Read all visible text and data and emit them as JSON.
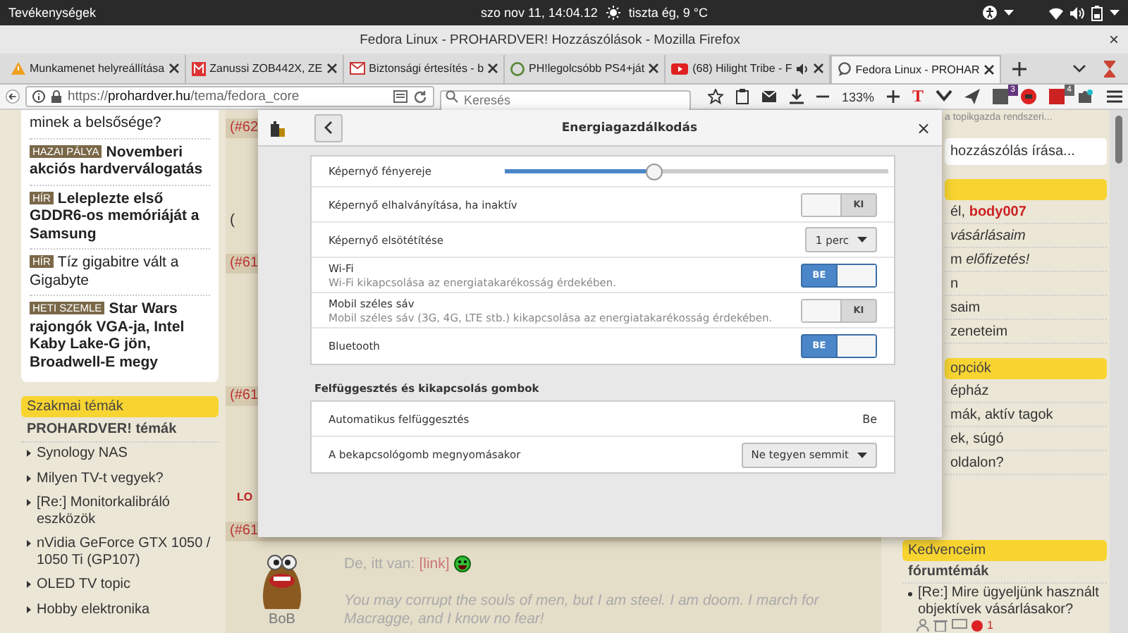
{
  "top_bar": {
    "activities": "Tevékenységek",
    "clock": "szo nov 11, 14:04.12",
    "weather": "tiszta ég, 9 °C"
  },
  "window": {
    "title": "Fedora Linux - PROHARDVER! Hozzászólások - Mozilla Firefox",
    "close": "×"
  },
  "tabs": [
    {
      "kind": "warning",
      "label": "Munkamenet helyreállítása",
      "audio": false,
      "selected": false
    },
    {
      "kind": "letter",
      "label": "Zanussi ZOB442X, ZE",
      "audio": false,
      "selected": false
    },
    {
      "kind": "mail",
      "label": "Biztonsági értesítés - b",
      "audio": false,
      "selected": false
    },
    {
      "kind": "circle",
      "label": "PH!legolcsóbb PS4+ját",
      "audio": false,
      "selected": false
    },
    {
      "kind": "play",
      "label": "(68) Hilight Tribe - F",
      "audio": true,
      "selected": false
    },
    {
      "kind": "bubble",
      "label": "Fedora Linux - PROHAR",
      "audio": false,
      "selected": true
    }
  ],
  "toolbar": {
    "url_scheme": "https://",
    "url_host": "prohardver.hu",
    "url_path": "/tema/fedora_core",
    "search_placeholder": "Keresés",
    "zoom": "133%",
    "logo_letter": "T",
    "badges": [
      "3",
      "4"
    ]
  },
  "left": {
    "news": [
      {
        "title": "minek a belsősége?",
        "bold": false
      },
      {
        "tag": "HAZAI PÁLYA",
        "title": "Novemberi akciós hardverválogatás",
        "bold": true
      },
      {
        "tag": "HÍR",
        "title": "Leleplezte első GDDR6-os memóriáját a Samsung",
        "bold": true
      },
      {
        "tag": "HÍR",
        "title": "Tíz gigabitre vált a Gigabyte",
        "bold": false
      },
      {
        "tag": "HETI SZEMLE",
        "title": "Star Wars rajongók VGA-ja, Intel Kaby Lake-G jön, Broadwell-E megy",
        "bold": true
      }
    ],
    "section": "Szakmai témák",
    "subheading": "PROHARDVER! témák",
    "topics": [
      "Synology NAS",
      "Milyen TV-t vegyek?",
      "[Re:] Monitorkalibráló eszközök",
      "nVidia GeForce GTX 1050 / 1050 Ti (GP107)",
      "OLED TV topic",
      "Hobby elektronika"
    ]
  },
  "middle": {
    "stubs": [
      {
        "number": "(#62",
        "trail": "(",
        "trail_flag": false
      },
      {
        "number": "(#61"
      },
      {
        "number": "(#61",
        "trail": "LO",
        "trail_flag": true
      }
    ],
    "post": {
      "number": "(#61",
      "author": "BoB",
      "text": "De, itt van: ",
      "link": "[link]",
      "signature": "You may corrupt the souls of men, but I am steel. I am doom. I march for Macragge, and I know no fear!"
    }
  },
  "right": {
    "notice": "a topikgazda rendszeri...",
    "compose": "hozzászólás írása...",
    "panels": [
      {
        "items": [
          {
            "text": "él, **body007**",
            "italic": false
          },
          {
            "text": "vásárlásaim",
            "italic": true
          },
          {
            "text": "m *előfizetés!*",
            "italic": false
          },
          {
            "text": "n",
            "italic": false
          },
          {
            "text": "saim",
            "italic": false
          },
          {
            "text": "zeneteim",
            "italic": false
          }
        ]
      },
      {
        "heading": "opciók",
        "items": [
          {
            "text": "épház",
            "italic": false
          },
          {
            "text": "mák, aktív tagok",
            "italic": false
          },
          {
            "text": "ek, súgó",
            "italic": false
          },
          {
            "text": "oldalon?",
            "italic": false
          }
        ]
      }
    ],
    "favorites": {
      "heading": "Kedvenceim",
      "subheading": "fórumtémák",
      "topic": "[Re:] Mire ügyeljünk használt objektívek vásárlásakor?",
      "count": "1"
    }
  },
  "dialog": {
    "title": "Energiagazdálkodás",
    "close": "×",
    "rows": [
      {
        "kind": "slider",
        "label": "Képernyő fényereje",
        "level": 0.39
      },
      {
        "kind": "switch",
        "label": "Képernyő elhalványítása, ha inaktív",
        "on": false,
        "state_text": "KI"
      },
      {
        "kind": "dropdown",
        "label": "Képernyő elsötétítése",
        "value": "1 perc"
      },
      {
        "kind": "switch",
        "label": "Wi-Fi",
        "description": "Wi-Fi kikapcsolása az energiatakarékosság érdekében.",
        "on": true,
        "state_text": "BE"
      },
      {
        "kind": "switch",
        "label": "Mobil széles sáv",
        "description": "Mobil széles sáv (3G, 4G, LTE stb.) kikapcsolása az energiatakarékosság érdekében.",
        "on": false,
        "state_text": "KI"
      },
      {
        "kind": "switch",
        "label": "Bluetooth",
        "on": true,
        "state_text": "BE"
      }
    ],
    "section": "Felfüggesztés és kikapcsolás gombok",
    "section_rows": [
      {
        "kind": "value",
        "label": "Automatikus felfüggesztés",
        "value": "Be"
      },
      {
        "kind": "dropdown",
        "label": "A bekapcsológomb megnyomásakor",
        "value": "Ne tegyen semmit"
      }
    ]
  }
}
